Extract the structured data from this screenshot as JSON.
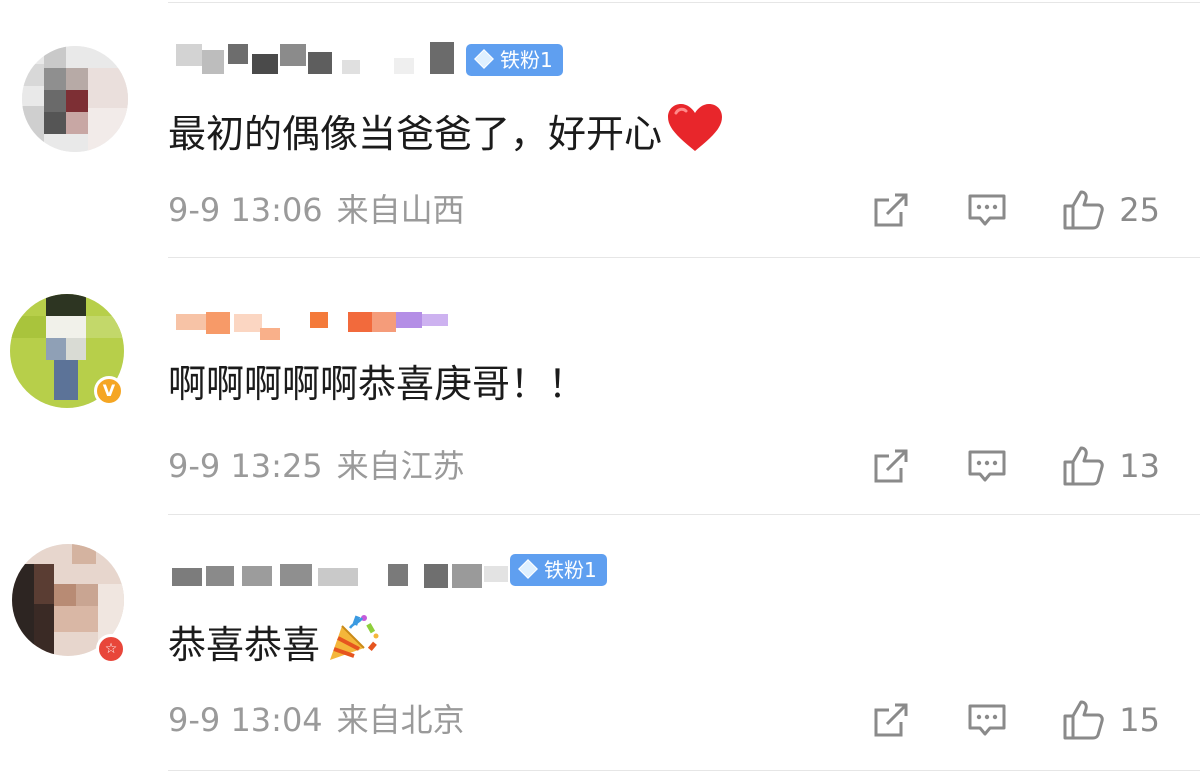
{
  "comments": [
    {
      "fan_badge": "铁粉1",
      "text": "最初的偶像当爸爸了，好开心",
      "emoji": "red-heart",
      "date_time": "9-9 13:06",
      "location": "来自山西",
      "likes": "25",
      "avatar_badge": ""
    },
    {
      "fan_badge": "",
      "text": "啊啊啊啊啊恭喜庚哥！！",
      "emoji": "",
      "date_time": "9-9 13:25",
      "location": "来自江苏",
      "likes": "13",
      "avatar_badge": "V"
    },
    {
      "fan_badge": "铁粉1",
      "text": "恭喜恭喜",
      "emoji": "party-popper",
      "date_time": "9-9 13:04",
      "location": "来自北京",
      "likes": "15",
      "avatar_badge": "☆"
    }
  ],
  "icons": {
    "repost": "repost-icon",
    "comment": "comment-icon",
    "like": "thumbs-up-icon"
  },
  "colors": {
    "fan_badge": "#5f9ff0",
    "meta_text": "#9a9a9a",
    "verified_badge": "#f5a623",
    "star_badge": "#e8463a",
    "heart": "#e8262b"
  }
}
